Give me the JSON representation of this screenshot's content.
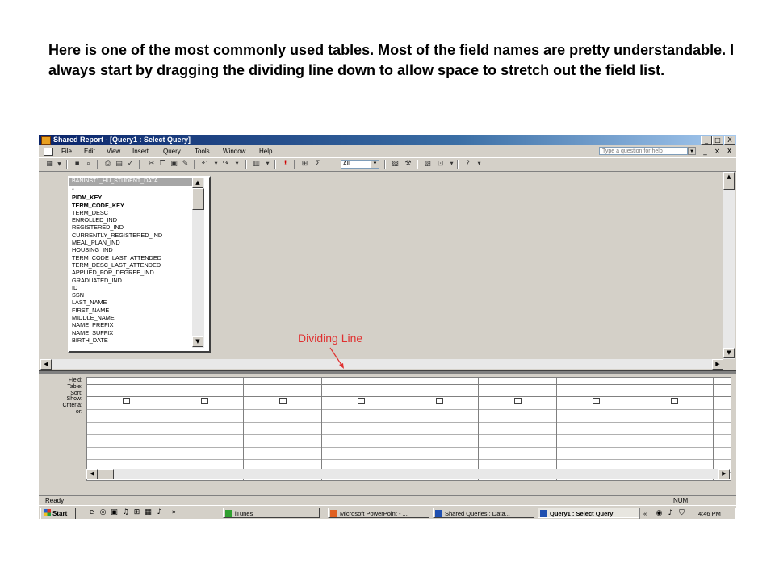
{
  "caption": "Here is one of the most commonly used tables.  Most of the field names are pretty understandable. I always start by dragging the dividing line down to allow space to stretch out the field list.",
  "window": {
    "title": "Shared Report - [Query1 : Select Query]",
    "caption_buttons": [
      "_",
      "□",
      "X"
    ],
    "mdi_buttons": [
      "_",
      "×",
      "X"
    ]
  },
  "menu": [
    "File",
    "Edit",
    "View",
    "Insert",
    "Query",
    "Tools",
    "Window",
    "Help"
  ],
  "ask_placeholder": "Type a question for help",
  "toolbar": {
    "top_values": "All"
  },
  "table": {
    "title": "BANINST1_HU_STUDENT_DATA",
    "fields": [
      {
        "name": "*",
        "bold": false
      },
      {
        "name": "PIDM_KEY",
        "bold": true
      },
      {
        "name": "TERM_CODE_KEY",
        "bold": true
      },
      {
        "name": "TERM_DESC",
        "bold": false
      },
      {
        "name": "ENROLLED_IND",
        "bold": false
      },
      {
        "name": "REGISTERED_IND",
        "bold": false
      },
      {
        "name": "CURRENTLY_REGISTERED_IND",
        "bold": false
      },
      {
        "name": "MEAL_PLAN_IND",
        "bold": false
      },
      {
        "name": "HOUSING_IND",
        "bold": false
      },
      {
        "name": "TERM_CODE_LAST_ATTENDED",
        "bold": false
      },
      {
        "name": "TERM_DESC_LAST_ATTENDED",
        "bold": false
      },
      {
        "name": "APPLIED_FOR_DEGREE_IND",
        "bold": false
      },
      {
        "name": "GRADUATED_IND",
        "bold": false
      },
      {
        "name": "ID",
        "bold": false
      },
      {
        "name": "SSN",
        "bold": false
      },
      {
        "name": "LAST_NAME",
        "bold": false
      },
      {
        "name": "FIRST_NAME",
        "bold": false
      },
      {
        "name": "MIDDLE_NAME",
        "bold": false
      },
      {
        "name": "NAME_PREFIX",
        "bold": false
      },
      {
        "name": "NAME_SUFFIX",
        "bold": false
      },
      {
        "name": "BIRTH_DATE",
        "bold": false
      }
    ]
  },
  "grid": {
    "row_labels": [
      "Field:",
      "Table:",
      "Sort:",
      "Show:",
      "Criteria:",
      "or:"
    ],
    "column_count": 9
  },
  "status": {
    "left": "Ready",
    "right": "NUM"
  },
  "taskbar": {
    "start": "Start",
    "overflow": "»",
    "tasks": [
      {
        "label": "iTunes",
        "active": false
      },
      {
        "label": "Microsoft PowerPoint - ...",
        "active": false
      },
      {
        "label": "Shared Queries : Data...",
        "active": false
      },
      {
        "label": "Query1 : Select Query",
        "active": true
      }
    ],
    "tray_overflow": "«",
    "clock": "4:46 PM"
  },
  "annotation": {
    "label": "Dividing Line",
    "color": "#e03030"
  }
}
